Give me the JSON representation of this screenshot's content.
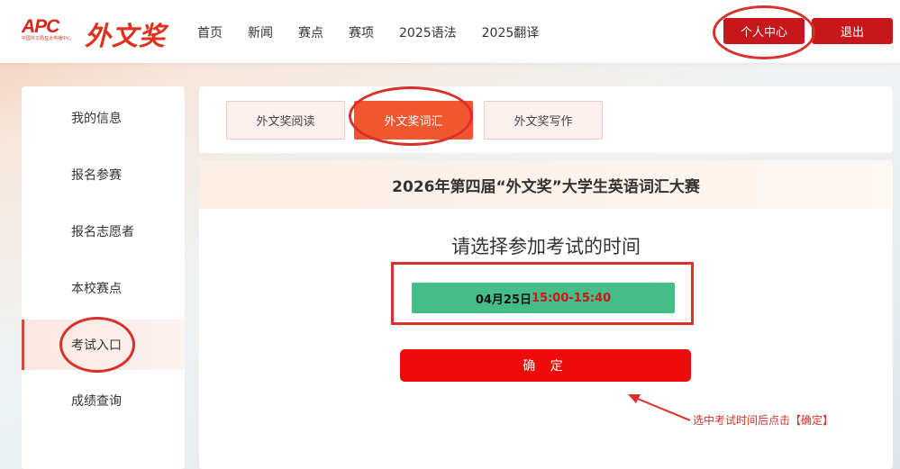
{
  "header": {
    "logo_brand": "APC",
    "logo_sub": "中国外文局亚太传播中心",
    "logo_name": "外文奖",
    "nav": [
      "首页",
      "新闻",
      "赛点",
      "赛项",
      "2025语法",
      "2025翻译"
    ],
    "personal_center": "个人中心",
    "logout": "退出"
  },
  "sidebar": {
    "items": [
      "我的信息",
      "报名参赛",
      "报名志愿者",
      "本校赛点",
      "考试入口",
      "成绩查询"
    ],
    "active": "考试入口"
  },
  "tabs": {
    "items": [
      "外文奖阅读",
      "外文奖词汇",
      "外文奖写作"
    ],
    "active": "外文奖词汇"
  },
  "main": {
    "title": "2026年第四届“外文奖”大学生英语词汇大赛",
    "prompt": "请选择参加考试的时间",
    "slot_date": "04月25日",
    "slot_time": "15:00-15:40",
    "confirm": "确 定",
    "hint": "选中考试时间后点击【确定】"
  },
  "colors": {
    "brand_red": "#c8161d",
    "tab_active": "#f0562f",
    "slot_green": "#44bd88",
    "confirm_red": "#ee0b0b",
    "annotation_red": "#d9302b"
  }
}
